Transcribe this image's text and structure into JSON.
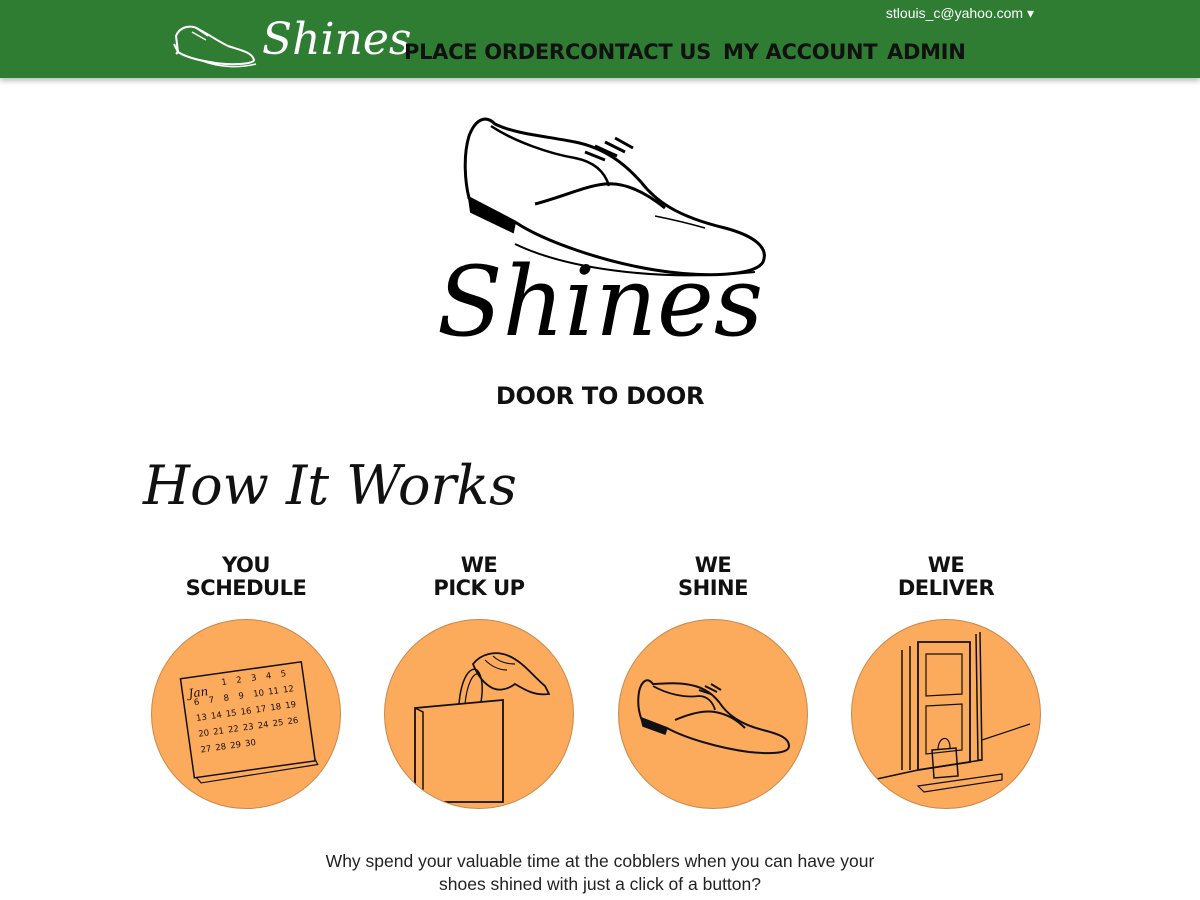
{
  "header": {
    "brand": "Shines",
    "nav": [
      {
        "label": "PLACE ORDER"
      },
      {
        "label": "CONTACT US"
      },
      {
        "label": "MY ACCOUNT"
      },
      {
        "label": "ADMIN"
      }
    ],
    "user_email": "stlouis_c@yahoo.com ▾",
    "bar_color": "#2e7d32"
  },
  "hero": {
    "title": "Shines",
    "tagline": "DOOR TO DOOR"
  },
  "how_it_works": {
    "title": "How It Works",
    "steps": [
      {
        "line1": "YOU",
        "line2": "SCHEDULE",
        "icon": "calendar-icon"
      },
      {
        "line1": "WE",
        "line2": "PICK UP",
        "icon": "hand-bag-icon"
      },
      {
        "line1": "WE",
        "line2": "SHINE",
        "icon": "shoe-icon"
      },
      {
        "line1": "WE",
        "line2": "DELIVER",
        "icon": "door-bag-icon"
      }
    ],
    "circle_color": "#fcaa5c"
  },
  "calendar": {
    "month": "Jan",
    "days": [
      "1",
      "2",
      "3",
      "4",
      "5",
      "6",
      "7",
      "8",
      "9",
      "10",
      "11",
      "12",
      "13",
      "14",
      "15",
      "16",
      "17",
      "18",
      "19",
      "20",
      "21",
      "22",
      "23",
      "24",
      "25",
      "26",
      "27",
      "28",
      "29",
      "30"
    ]
  },
  "footer": {
    "line1": "Why spend your valuable time at the cobblers when you can have your",
    "line2": "shoes shined with just a click of a button?"
  }
}
